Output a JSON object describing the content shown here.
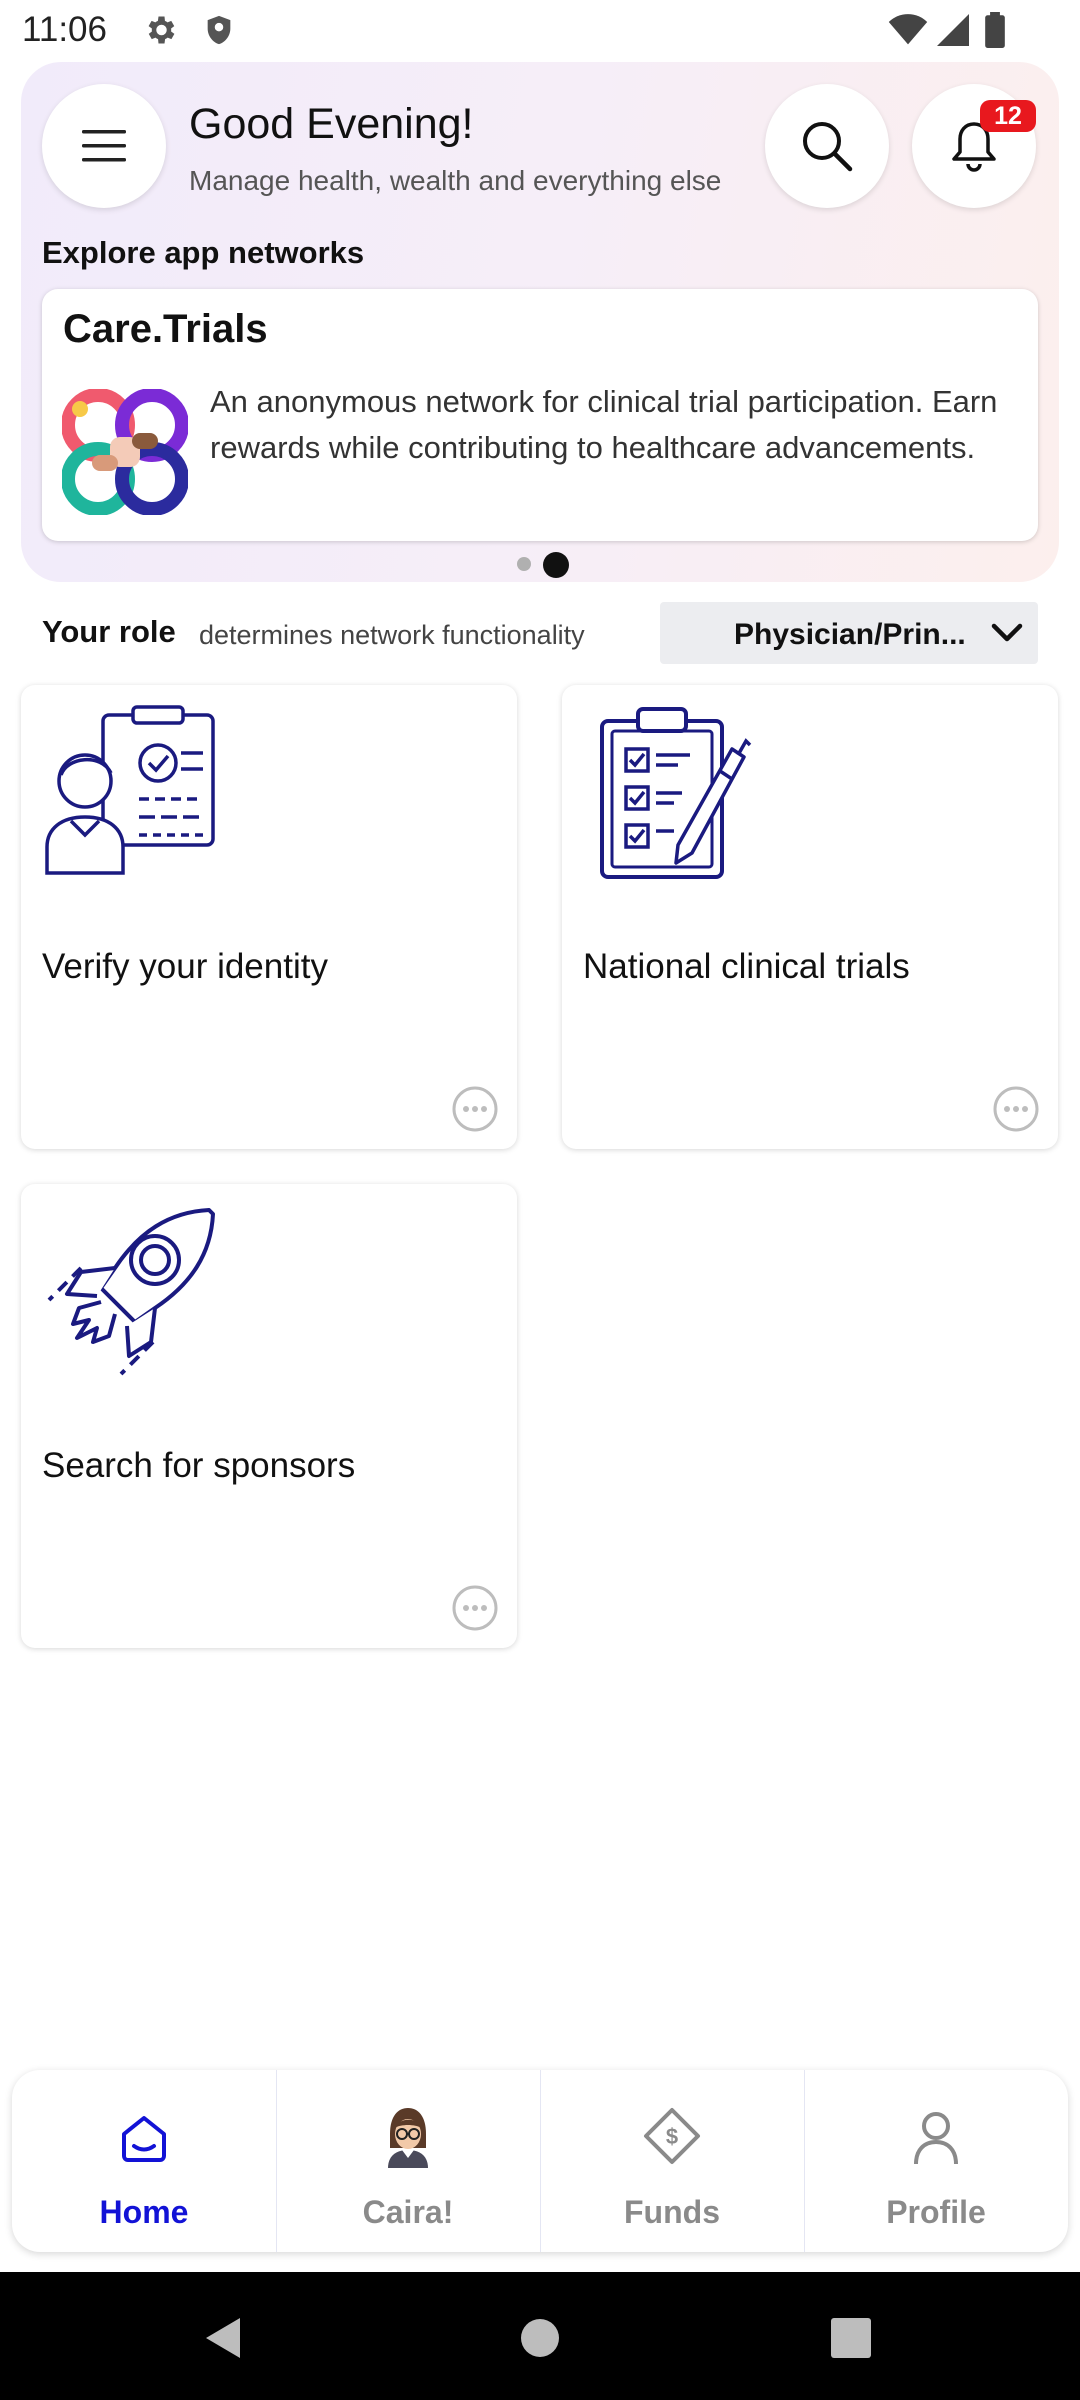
{
  "status_bar": {
    "time": "11:06"
  },
  "header": {
    "greeting": "Good Evening!",
    "subtitle": "Manage health, wealth and everything else",
    "notification_count": "12"
  },
  "explore": {
    "heading": "Explore app networks",
    "network": {
      "title": "Care.Trials",
      "description": "An anonymous network for clinical trial participation. Earn rewards while contributing to healthcare advancements."
    },
    "carousel": {
      "active_index": 1,
      "count": 2
    }
  },
  "role": {
    "label": "Your role",
    "description": "determines network functionality",
    "selected": "Physician/Prin..."
  },
  "tiles": [
    {
      "label": "Verify your identity",
      "icon": "identity-verification-icon"
    },
    {
      "label": "National clinical trials",
      "icon": "clipboard-checklist-icon"
    },
    {
      "label": "Search for sponsors",
      "icon": "rocket-icon"
    }
  ],
  "bottom_nav": [
    {
      "label": "Home",
      "icon": "home-icon",
      "active": true
    },
    {
      "label": "Caira!",
      "icon": "caira-avatar-icon",
      "active": false
    },
    {
      "label": "Funds",
      "icon": "funds-icon",
      "active": false
    },
    {
      "label": "Profile",
      "icon": "profile-icon",
      "active": false
    }
  ],
  "colors": {
    "accent": "#1212d6",
    "icon_navy": "#1a1a80",
    "badge": "#e8181e"
  }
}
